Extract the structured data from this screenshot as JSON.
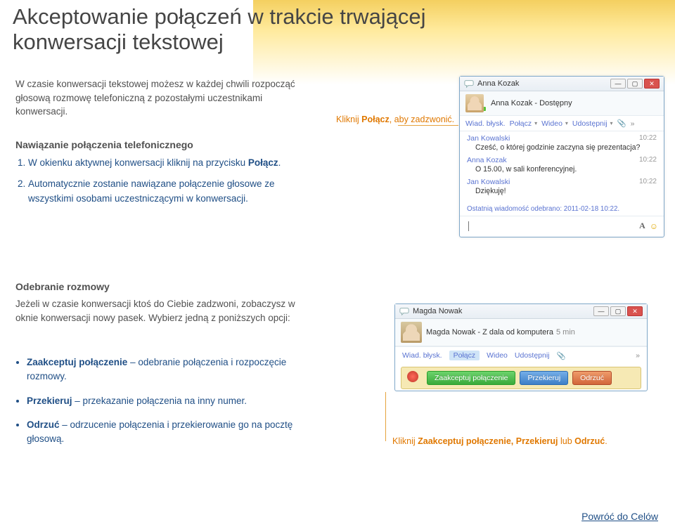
{
  "page": {
    "title": "Akceptowanie połączeń w trakcie trwającej konwersacji tekstowej",
    "intro": "W czasie konwersacji tekstowej możesz w każdej chwili rozpocząć głosową rozmowę telefoniczną z pozostałymi uczestnikami konwersacji.",
    "section1_head": "Nawiązanie połączenia telefonicznego",
    "step1_pre": "W okienku aktywnej konwersacji kliknij na przycisku ",
    "step1_bold": "Połącz",
    "step1_post": ".",
    "step2": "Automatycznie zostanie nawiązane połączenie głosowe ze wszystkimi osobami uczestniczącymi w konwersacji.",
    "section2_head": "Odebranie rozmowy",
    "section2_para": "Jeżeli w czasie konwersacji ktoś do Ciebie zadzwoni, zobaczysz w oknie konwersacji nowy pasek. Wybierz jedną z poniższych opcji:",
    "b1_bold": "Zaakceptuj połączenie",
    "b1_rest": " – odebranie połączenia i rozpoczęcie rozmowy.",
    "b2_bold": "Przekieruj",
    "b2_rest": " – przekazanie połączenia na inny numer.",
    "b3_bold": "Odrzuć",
    "b3_rest": " – odrzucenie połączenia i przekierowanie go na pocztę głosową.",
    "callout1_pre": "Kliknij ",
    "callout1_bold": "Połącz",
    "callout1_post": ", aby zadzwonić.",
    "callout2_pre": "Kliknij ",
    "callout2_bold": "Zaakceptuj połączenie, Przekieruj",
    "callout2_mid": " lub ",
    "callout2_bold2": "Odrzuć",
    "callout2_post": ".",
    "back_link": "Powróć do Celów"
  },
  "chat1": {
    "title": "Anna Kozak",
    "presence": "Anna Kozak - Dostępny",
    "tb_wiad": "Wiad. błysk.",
    "tb_polacz": "Połącz",
    "tb_wideo": "Wideo",
    "tb_udost": "Udostępnij",
    "messages": [
      {
        "name": "Jan Kowalski",
        "time": "10:22",
        "body": "Cześć, o której godzinie zaczyna się prezentacja?"
      },
      {
        "name": "Anna Kozak",
        "time": "10:22",
        "body": "O 15.00, w sali konferencyjnej."
      },
      {
        "name": "Jan Kowalski",
        "time": "10:22",
        "body": "Dziękuję!"
      }
    ],
    "lastrecv": "Ostatnią wiadomość odebrano: 2011-02-18 10:22.",
    "font_label": "A"
  },
  "chat2": {
    "title": "Magda Nowak",
    "presence": "Magda Nowak - Z dala od komputera",
    "presence_time": "5 min",
    "tb_wiad": "Wiad. błysk.",
    "tb_polacz": "Połącz",
    "tb_wideo": "Wideo",
    "tb_udost": "Udostępnij",
    "btn_accept": "Zaakceptuj połączenie",
    "btn_redirect": "Przekieruj",
    "btn_reject": "Odrzuć"
  }
}
